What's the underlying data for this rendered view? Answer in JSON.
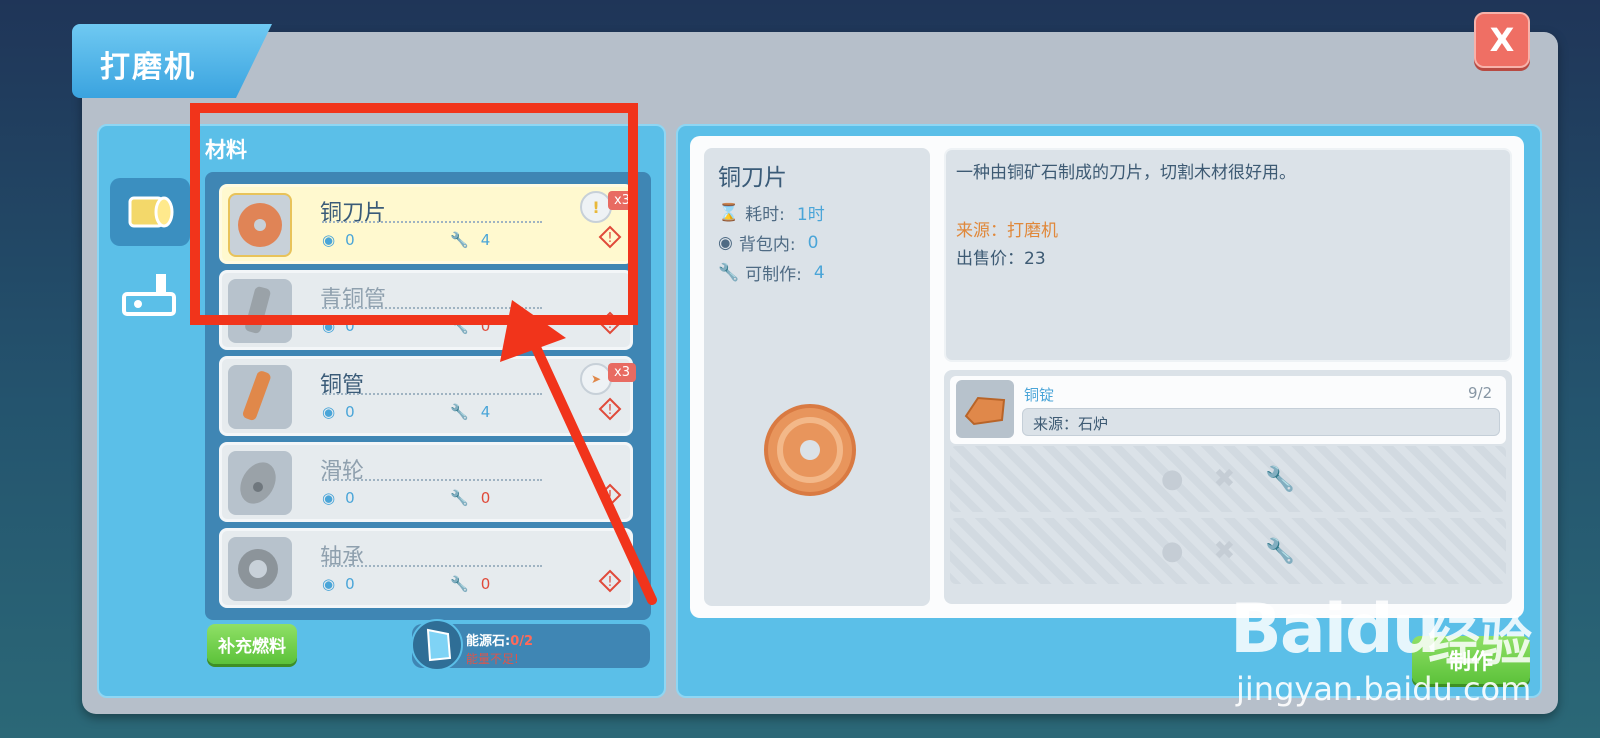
{
  "window": {
    "title": "打磨机",
    "close_label": "X"
  },
  "left_panel": {
    "section_label": "材料",
    "categories": [
      {
        "icon": "machine-part-icon",
        "active": true
      },
      {
        "icon": "factory-icon",
        "active": false
      }
    ],
    "items": [
      {
        "name": "铜刀片",
        "in_bag": "0",
        "craftable": "4",
        "selected": true,
        "badge": "x3",
        "hint_icon": "exclamation-icon"
      },
      {
        "name": "青铜管",
        "in_bag": "0",
        "craftable": "0",
        "selected": false
      },
      {
        "name": "铜管",
        "in_bag": "0",
        "craftable": "4",
        "selected": false,
        "badge": "x3"
      },
      {
        "name": "滑轮",
        "in_bag": "0",
        "craftable": "0",
        "selected": false
      },
      {
        "name": "轴承",
        "in_bag": "0",
        "craftable": "0",
        "selected": false
      }
    ],
    "refuel_button": "补充燃料",
    "energy": {
      "label": "能源石:",
      "value": "0/2",
      "warning": "能量不足!"
    }
  },
  "detail": {
    "title": "铜刀片",
    "time_label": "耗时:",
    "time_value": "1时",
    "bag_label": "背包内:",
    "bag_value": "0",
    "craft_label": "可制作:",
    "craft_value": "4",
    "description": "一种由铜矿石制成的刀片，切割木材很好用。",
    "source": "来源：打磨机",
    "price": "出售价：23",
    "materials": [
      {
        "name": "铜锭",
        "count": "9/2",
        "source": "来源：石炉"
      }
    ],
    "craft_button": "制作"
  },
  "watermark": {
    "logo": "Bai",
    "logo2": "du",
    "cn": "经验",
    "url": "jingyan.baidu.com"
  },
  "colors": {
    "annotation": "#f1341b",
    "panel": "#5bbfe8",
    "accent_green": "#5cc23a"
  }
}
